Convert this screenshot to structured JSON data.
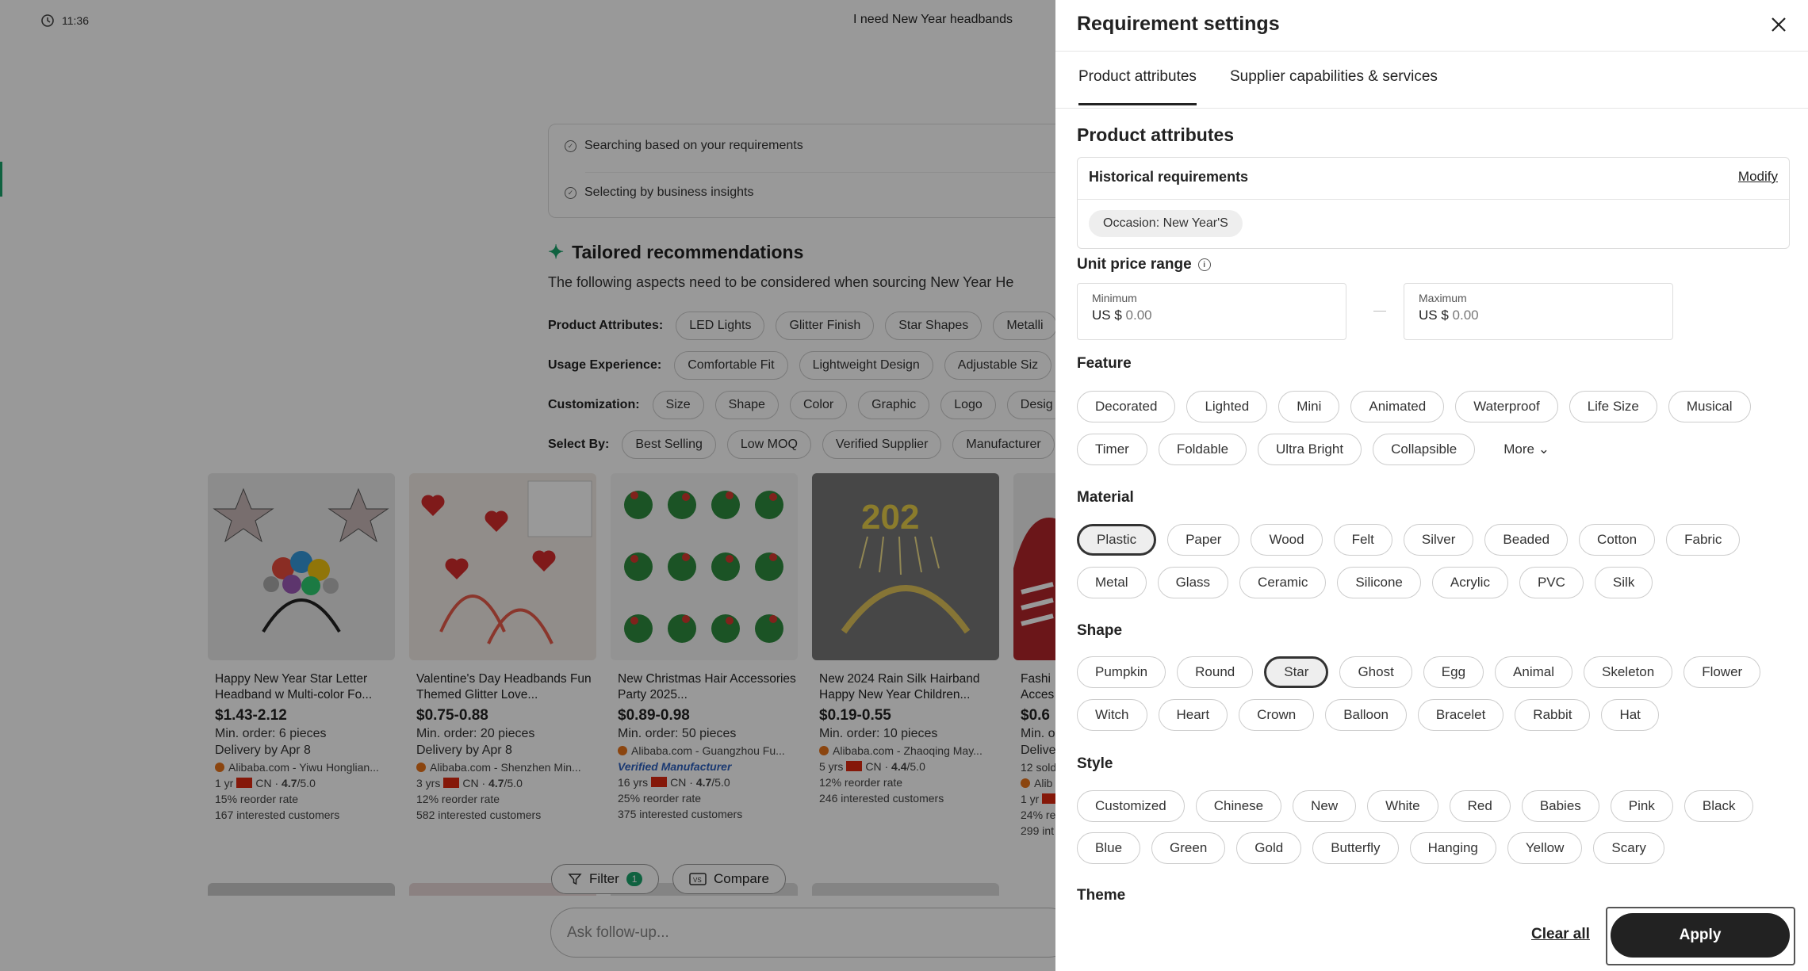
{
  "background": {
    "time": "11:36",
    "query": "I need New Year headbands",
    "status": [
      "Searching based on your requirements",
      "Selecting by business insights"
    ],
    "tailored_title": "Tailored recommendations",
    "aspects_text": "The following aspects need to be considered when sourcing New Year He",
    "criteria": [
      {
        "label": "Product Attributes:",
        "chips": [
          "LED Lights",
          "Glitter Finish",
          "Star Shapes",
          "Metalli"
        ]
      },
      {
        "label": "Usage Experience:",
        "chips": [
          "Comfortable Fit",
          "Lightweight Design",
          "Adjustable Siz"
        ]
      },
      {
        "label": "Customization:",
        "chips": [
          "Size",
          "Shape",
          "Color",
          "Graphic",
          "Logo",
          "Desig"
        ]
      },
      {
        "label": "Select By:",
        "chips": [
          "Best Selling",
          "Low MOQ",
          "Verified Supplier",
          "Manufacturer"
        ]
      }
    ],
    "cards": [
      {
        "title": "Happy New Year Star Letter Headband w Multi-color Fo...",
        "price": "$1.43-2.12",
        "min": "Min. order: 6 pieces",
        "delivery": "Delivery by Apr 8",
        "supplier": "Alibaba.com - Yiwu Honglian...",
        "years": "1 yr",
        "rating": "4.7",
        "reorder": "15% reorder rate",
        "interested": "167 interested customers"
      },
      {
        "title": "Valentine's Day Headbands Fun Themed Glitter Love...",
        "price": "$0.75-0.88",
        "min": "Min. order: 20 pieces",
        "delivery": "Delivery by Apr 8",
        "supplier": "Alibaba.com - Shenzhen Min...",
        "years": "3 yrs",
        "rating": "4.7",
        "reorder": "12% reorder rate",
        "interested": "582 interested customers"
      },
      {
        "title": "New Christmas Hair Accessories Party 2025...",
        "price": "$0.89-0.98",
        "min": "Min. order: 50 pieces",
        "supplier": "Alibaba.com - Guangzhou Fu...",
        "verified": "Verified Manufacturer",
        "years": "16 yrs",
        "rating": "4.7",
        "reorder": "25% reorder rate",
        "interested": "375 interested customers"
      },
      {
        "title": "New 2024 Rain Silk Hairband Happy New Year Children...",
        "price": "$0.19-0.55",
        "min": "Min. order: 10 pieces",
        "supplier": "Alibaba.com - Zhaoqing May...",
        "years": "5 yrs",
        "rating": "4.4",
        "reorder": "12% reorder rate",
        "interested": "246 interested customers"
      },
      {
        "title": "Fashi Acces",
        "price": "$0.6",
        "min": "Min. o",
        "delivery": "Delive",
        "sold": "12 sold",
        "supplier": "Alib",
        "years": "1 yr",
        "reorder": "24% re",
        "interested": "299 int"
      }
    ],
    "cn": "CN",
    "rating_suffix": "/5.0",
    "filter_label": "Filter",
    "filter_count": "1",
    "compare_label": "Compare",
    "ask_placeholder": "Ask follow-up..."
  },
  "panel": {
    "title": "Requirement settings",
    "tabs": [
      "Product attributes",
      "Supplier capabilities & services"
    ],
    "section_title": "Product attributes",
    "historical": {
      "title": "Historical requirements",
      "modify": "Modify",
      "chip": "Occasion: New Year'S"
    },
    "price": {
      "label": "Unit price range",
      "min_caption": "Minimum",
      "max_caption": "Maximum",
      "currency": "US $",
      "min_value": "0.00",
      "max_value": "0.00"
    },
    "feature": {
      "label": "Feature",
      "row1": [
        "Decorated",
        "Lighted",
        "Mini",
        "Animated",
        "Waterproof",
        "Life Size",
        "Musical"
      ],
      "row2": [
        "Timer",
        "Foldable",
        "Ultra Bright",
        "Collapsible"
      ],
      "more": "More"
    },
    "material": {
      "label": "Material",
      "row1": [
        "Plastic",
        "Paper",
        "Wood",
        "Felt",
        "Silver",
        "Beaded",
        "Cotton",
        "Fabric"
      ],
      "row2": [
        "Metal",
        "Glass",
        "Ceramic",
        "Silicone",
        "Acrylic",
        "PVC",
        "Silk"
      ],
      "selected": "Plastic"
    },
    "shape": {
      "label": "Shape",
      "row1": [
        "Pumpkin",
        "Round",
        "Star",
        "Ghost",
        "Egg",
        "Animal",
        "Skeleton",
        "Flower"
      ],
      "row2": [
        "Witch",
        "Heart",
        "Crown",
        "Balloon",
        "Bracelet",
        "Rabbit",
        "Hat"
      ],
      "selected": "Star"
    },
    "style": {
      "label": "Style",
      "row1": [
        "Customized",
        "Chinese",
        "New",
        "White",
        "Red",
        "Babies",
        "Pink",
        "Black"
      ],
      "row2": [
        "Blue",
        "Green",
        "Gold",
        "Butterfly",
        "Hanging",
        "Yellow",
        "Scary"
      ]
    },
    "theme": {
      "label": "Theme"
    },
    "clear_all": "Clear all",
    "apply": "Apply"
  },
  "colors": {
    "accent_green": "#1aa36b",
    "apply_bg": "#222222",
    "overlay": "rgba(0,0,0,0.40)"
  },
  "icons": [
    "history-icon",
    "check-circle-icon",
    "sparkle-icon",
    "filter-icon",
    "compare-icon",
    "close-icon",
    "info-icon",
    "chevron-down-icon",
    "supplier-icon",
    "china-flag-icon"
  ]
}
